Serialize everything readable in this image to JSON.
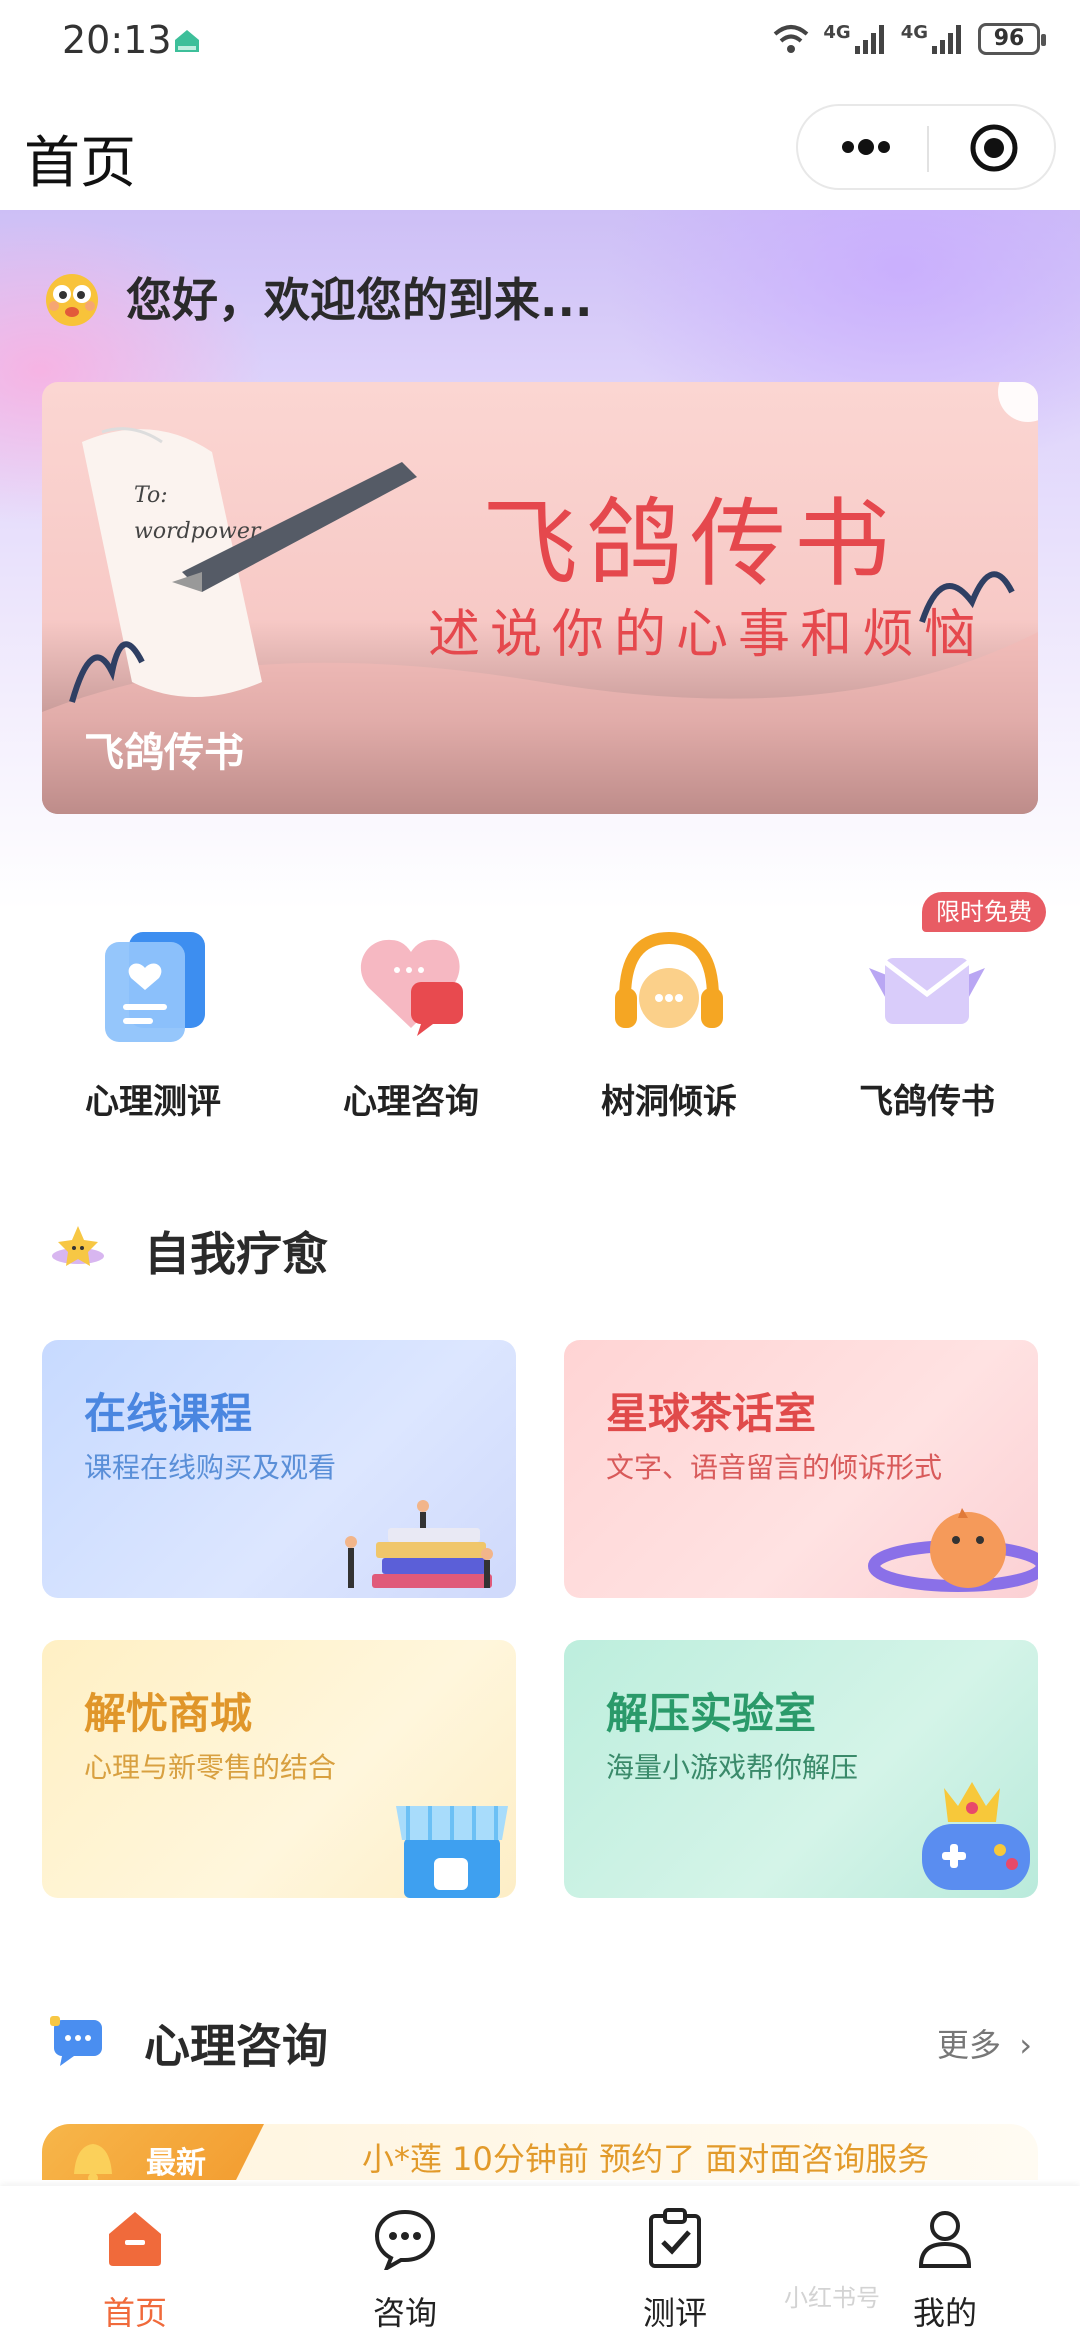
{
  "status_bar": {
    "time": "20:13",
    "battery": "96",
    "network_1": "4G",
    "network_2": "4G"
  },
  "title_bar": {
    "title": "首页"
  },
  "greeting": {
    "text": "您好，欢迎您的到来..."
  },
  "banner": {
    "title": "飞鸽传书",
    "subtitle": "述说你的心事和烦恼",
    "caption": "飞鸽传书",
    "handwriting_1": "To:",
    "handwriting_2": "wordpower"
  },
  "quick_entries": [
    {
      "label": "心理测评",
      "icon": "heart-card-icon"
    },
    {
      "label": "心理咨询",
      "icon": "heart-chat-icon"
    },
    {
      "label": "树洞倾诉",
      "icon": "headphone-chat-icon"
    },
    {
      "label": "飞鸽传书",
      "icon": "winged-envelope-icon",
      "badge": "限时免费"
    }
  ],
  "self_healing": {
    "title": "自我疗愈",
    "cards": [
      {
        "title": "在线课程",
        "desc": "课程在线购买及观看",
        "title_color": "#4a86e0",
        "desc_color": "#5a8fd8"
      },
      {
        "title": "星球茶话室",
        "desc": "文字、语音留言的倾诉形式",
        "title_color": "#e04a4a",
        "desc_color": "#d85a5a"
      },
      {
        "title": "解忧商城",
        "desc": "心理与新零售的结合",
        "title_color": "#e0962a",
        "desc_color": "#d8a040"
      },
      {
        "title": "解压实验室",
        "desc": "海量小游戏帮你解压",
        "title_color": "#2a9a6a",
        "desc_color": "#3a8a6a"
      }
    ]
  },
  "consult": {
    "title": "心理咨询",
    "more": "更多",
    "notice_tag": "最新",
    "notice_text": "小*莲 10分钟前 预约了 面对面咨询服务"
  },
  "tabs": [
    {
      "label": "首页",
      "icon": "home-icon",
      "active": true
    },
    {
      "label": "咨询",
      "icon": "chat-bubble-icon",
      "active": false
    },
    {
      "label": "测评",
      "icon": "clipboard-check-icon",
      "active": false
    },
    {
      "label": "我的",
      "icon": "user-icon",
      "active": false
    }
  ],
  "watermark": "小红书号"
}
